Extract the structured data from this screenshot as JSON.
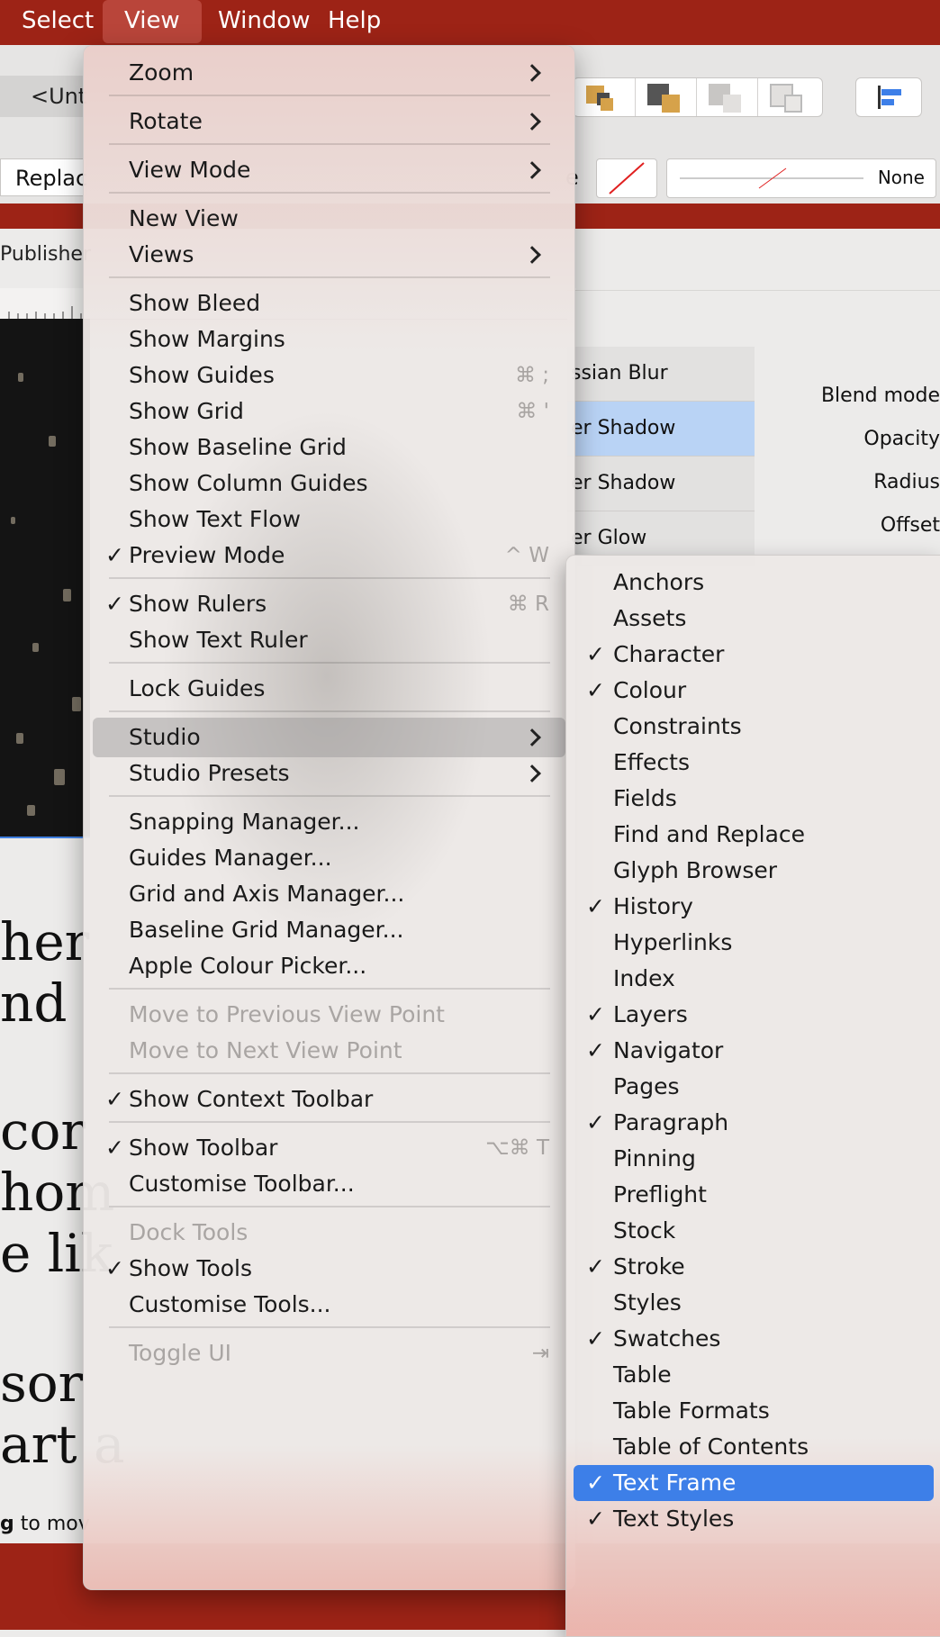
{
  "menubar": {
    "items": [
      {
        "label": "Select"
      },
      {
        "label": "View",
        "active": true
      },
      {
        "label": "Window"
      },
      {
        "label": "Help"
      }
    ]
  },
  "toolbar": {
    "doc_tab": "<Unt",
    "replace_field": "Replac",
    "style_field": "e",
    "stroke_value": "None"
  },
  "canvas": {
    "publisher_label": "Publisher",
    "article_lines": [
      "her",
      "nd",
      "cor",
      "hom",
      "e lik",
      "sor",
      "art a"
    ],
    "status_hint_bold": "g",
    "status_hint_rest": " to mov"
  },
  "effects_panel": {
    "effects": [
      {
        "label": "ssian Blur"
      },
      {
        "label": "er Shadow",
        "selected": true
      },
      {
        "label": "er Shadow"
      },
      {
        "label": "er Glow"
      }
    ],
    "properties": [
      "Blend mode",
      "Opacity",
      "Radius",
      "Offset"
    ]
  },
  "view_menu": {
    "items": [
      {
        "label": "Zoom",
        "submenu": true
      },
      {
        "separator": true
      },
      {
        "label": "Rotate",
        "submenu": true
      },
      {
        "separator": true
      },
      {
        "label": "View Mode",
        "submenu": true
      },
      {
        "separator": true
      },
      {
        "label": "New View"
      },
      {
        "label": "Views",
        "submenu": true
      },
      {
        "separator": true
      },
      {
        "label": "Show Bleed"
      },
      {
        "label": "Show Margins"
      },
      {
        "label": "Show Guides",
        "shortcut": "⌘ ;"
      },
      {
        "label": "Show Grid",
        "shortcut": "⌘ '"
      },
      {
        "label": "Show Baseline Grid"
      },
      {
        "label": "Show Column Guides"
      },
      {
        "label": "Show Text Flow"
      },
      {
        "label": "Preview Mode",
        "checked": true,
        "shortcut": "^ W"
      },
      {
        "separator": true
      },
      {
        "label": "Show Rulers",
        "checked": true,
        "shortcut": "⌘ R"
      },
      {
        "label": "Show Text Ruler"
      },
      {
        "separator": true
      },
      {
        "label": "Lock Guides"
      },
      {
        "separator": true
      },
      {
        "label": "Studio",
        "submenu": true,
        "highlighted": true
      },
      {
        "label": "Studio Presets",
        "submenu": true
      },
      {
        "separator": true
      },
      {
        "label": "Snapping Manager..."
      },
      {
        "label": "Guides Manager..."
      },
      {
        "label": "Grid and Axis Manager..."
      },
      {
        "label": "Baseline Grid Manager..."
      },
      {
        "label": "Apple Colour Picker..."
      },
      {
        "separator": true
      },
      {
        "label": "Move to Previous View Point",
        "disabled": true
      },
      {
        "label": "Move to Next View Point",
        "disabled": true
      },
      {
        "separator": true
      },
      {
        "label": "Show Context Toolbar",
        "checked": true
      },
      {
        "separator": true
      },
      {
        "label": "Show Toolbar",
        "checked": true,
        "shortcut": "⌥⌘ T"
      },
      {
        "label": "Customise Toolbar..."
      },
      {
        "separator": true
      },
      {
        "label": "Dock Tools",
        "disabled": true
      },
      {
        "label": "Show Tools",
        "checked": true
      },
      {
        "label": "Customise Tools..."
      },
      {
        "separator": true
      },
      {
        "label": "Toggle UI",
        "disabled": true,
        "shortcut": "⇥"
      }
    ]
  },
  "studio_submenu": {
    "items": [
      {
        "label": "Anchors"
      },
      {
        "label": "Assets"
      },
      {
        "label": "Character",
        "checked": true
      },
      {
        "label": "Colour",
        "checked": true
      },
      {
        "label": "Constraints"
      },
      {
        "label": "Effects"
      },
      {
        "label": "Fields"
      },
      {
        "label": "Find and Replace"
      },
      {
        "label": "Glyph Browser"
      },
      {
        "label": "History",
        "checked": true
      },
      {
        "label": "Hyperlinks"
      },
      {
        "label": "Index"
      },
      {
        "label": "Layers",
        "checked": true
      },
      {
        "label": "Navigator",
        "checked": true
      },
      {
        "label": "Pages"
      },
      {
        "label": "Paragraph",
        "checked": true
      },
      {
        "label": "Pinning"
      },
      {
        "label": "Preflight"
      },
      {
        "label": "Stock"
      },
      {
        "label": "Stroke",
        "checked": true
      },
      {
        "label": "Styles"
      },
      {
        "label": "Swatches",
        "checked": true
      },
      {
        "label": "Table"
      },
      {
        "label": "Table Formats"
      },
      {
        "label": "Table of Contents"
      },
      {
        "label": "Text Frame",
        "checked": true,
        "selected": true
      },
      {
        "label": "Text Styles",
        "checked": true
      }
    ]
  },
  "check_glyph": "✓",
  "colors": {
    "menubar": "#9d2316",
    "selection": "#3d7fe8",
    "effect_selected": "#b9d3f5"
  }
}
